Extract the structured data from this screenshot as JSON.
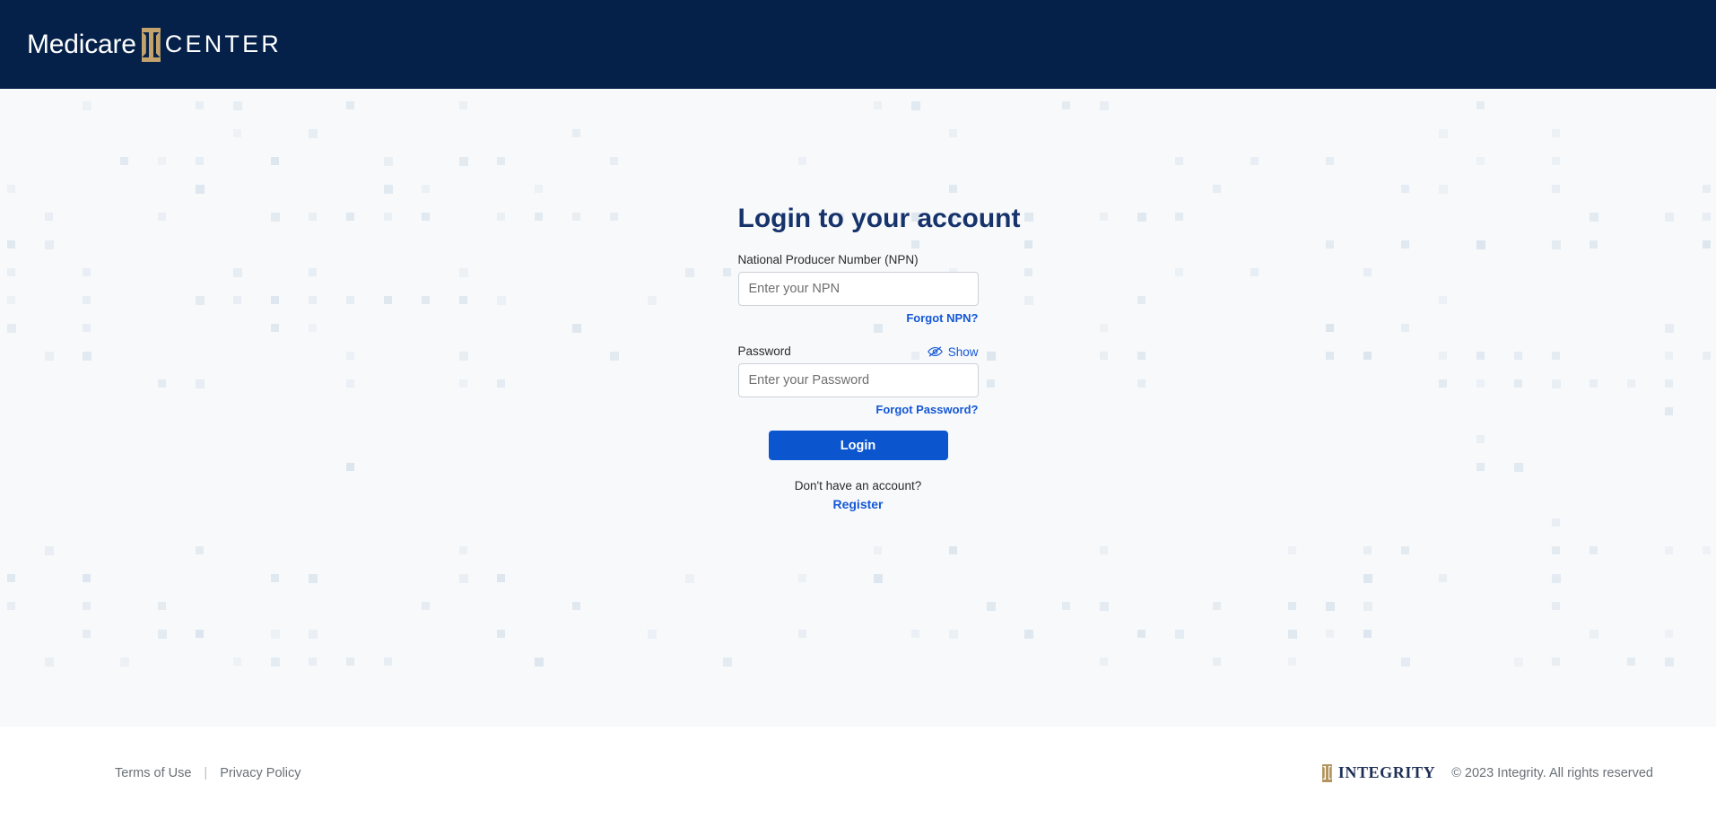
{
  "header": {
    "logo_primary": "Medicare",
    "logo_mark": "ibeam-icon",
    "logo_secondary": "CENTER",
    "background_color": "#05214a",
    "mark_color": "#c3a36b"
  },
  "main": {
    "background_color": "#f7f9fb",
    "pattern": {
      "square_color": "#dde6ee",
      "square_size_px": 9
    },
    "title": "Login to your account",
    "title_color": "#17336b",
    "npn": {
      "label": "National Producer Number (NPN)",
      "placeholder": "Enter your NPN",
      "value": "",
      "forgot_link": "Forgot NPN?"
    },
    "password": {
      "label": "Password",
      "placeholder": "Enter your Password",
      "value": "",
      "show_toggle_label": "Show",
      "show_toggle_icon": "eye-slash-icon",
      "forgot_link": "Forgot Password?"
    },
    "login_button": {
      "label": "Login",
      "color": "#0b55cf"
    },
    "signup_prompt": "Don't have an account?",
    "register_link": "Register",
    "link_color": "#1558d6"
  },
  "footer": {
    "terms_link": "Terms of Use",
    "separator": "|",
    "privacy_link": "Privacy Policy",
    "integrity_mark": "ibeam-icon",
    "integrity_word": "INTEGRITY",
    "copyright": "© 2023 Integrity. All rights reserved",
    "text_color": "#6a7077"
  }
}
